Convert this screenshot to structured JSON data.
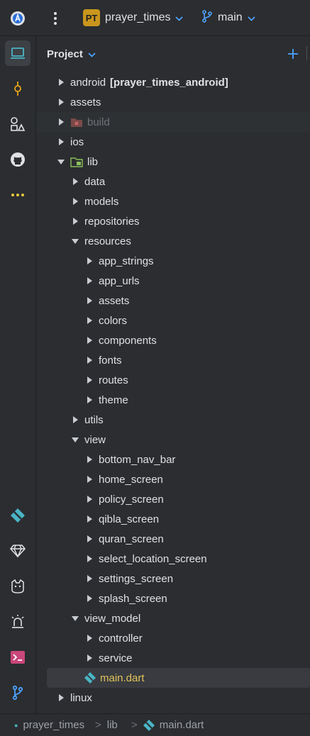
{
  "topbar": {
    "project_badge": "PT",
    "project_name": "prayer_times",
    "branch": "main"
  },
  "panel": {
    "title": "Project"
  },
  "tree": [
    {
      "label": "android",
      "tag": "[prayer_times_android]",
      "depth": 0,
      "expanded": false
    },
    {
      "label": "assets",
      "depth": 0,
      "expanded": false
    },
    {
      "label": "build",
      "depth": 0,
      "expanded": false,
      "dim": true
    },
    {
      "label": "ios",
      "depth": 0,
      "expanded": false
    },
    {
      "label": "lib",
      "depth": 0,
      "expanded": true
    },
    {
      "label": "data",
      "depth": 1,
      "expanded": false
    },
    {
      "label": "models",
      "depth": 1,
      "expanded": false
    },
    {
      "label": "repositories",
      "depth": 1,
      "expanded": false
    },
    {
      "label": "resources",
      "depth": 1,
      "expanded": true
    },
    {
      "label": "app_strings",
      "depth": 2,
      "expanded": false
    },
    {
      "label": "app_urls",
      "depth": 2,
      "expanded": false
    },
    {
      "label": "assets",
      "depth": 2,
      "expanded": false
    },
    {
      "label": "colors",
      "depth": 2,
      "expanded": false
    },
    {
      "label": "components",
      "depth": 2,
      "expanded": false
    },
    {
      "label": "fonts",
      "depth": 2,
      "expanded": false
    },
    {
      "label": "routes",
      "depth": 2,
      "expanded": false
    },
    {
      "label": "theme",
      "depth": 2,
      "expanded": false
    },
    {
      "label": "utils",
      "depth": 1,
      "expanded": false
    },
    {
      "label": "view",
      "depth": 1,
      "expanded": true
    },
    {
      "label": "bottom_nav_bar",
      "depth": 2,
      "expanded": false
    },
    {
      "label": "home_screen",
      "depth": 2,
      "expanded": false
    },
    {
      "label": "policy_screen",
      "depth": 2,
      "expanded": false
    },
    {
      "label": "qibla_screen",
      "depth": 2,
      "expanded": false
    },
    {
      "label": "quran_screen",
      "depth": 2,
      "expanded": false
    },
    {
      "label": "select_location_screen",
      "depth": 2,
      "expanded": false
    },
    {
      "label": "settings_screen",
      "depth": 2,
      "expanded": false
    },
    {
      "label": "splash_screen",
      "depth": 2,
      "expanded": false
    },
    {
      "label": "view_model",
      "depth": 1,
      "expanded": true
    },
    {
      "label": "controller",
      "depth": 2,
      "expanded": false
    },
    {
      "label": "service",
      "depth": 2,
      "expanded": false
    },
    {
      "label": "main.dart",
      "depth": 2,
      "file": true
    },
    {
      "label": "linux",
      "depth": 0,
      "expanded": false
    }
  ],
  "statusbar": {
    "crumbs": [
      "prayer_times",
      "lib",
      "main.dart"
    ]
  },
  "colors": {
    "accent_blue": "#4da3ff",
    "folder_green": "#8bbf5a",
    "dart_teal": "#49b5c5",
    "main_file_yellow": "#e0c35a"
  }
}
